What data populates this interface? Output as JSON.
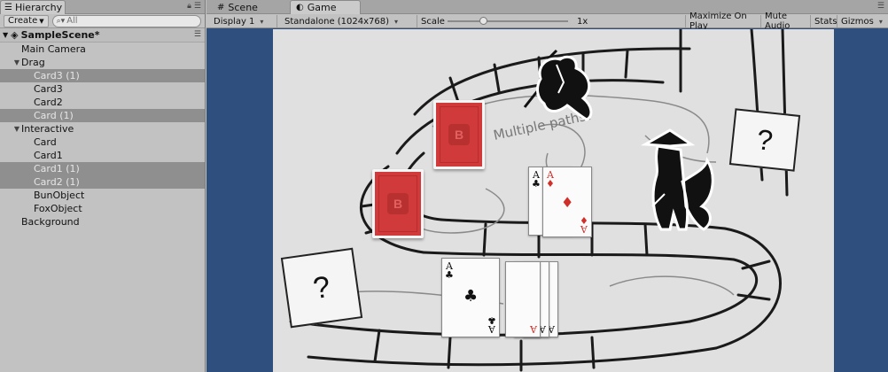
{
  "hierarchy": {
    "tab_label": "Hierarchy",
    "create_label": "Create",
    "search_placeholder": "All",
    "scene_name": "SampleScene*",
    "items": [
      {
        "label": "Main Camera",
        "depth": 1,
        "selected": false,
        "expander": ""
      },
      {
        "label": "Drag",
        "depth": 1,
        "selected": false,
        "expander": "▼"
      },
      {
        "label": "Card3 (1)",
        "depth": 2,
        "selected": true,
        "expander": ""
      },
      {
        "label": "Card3",
        "depth": 2,
        "selected": false,
        "expander": ""
      },
      {
        "label": "Card2",
        "depth": 2,
        "selected": false,
        "expander": ""
      },
      {
        "label": "Card (1)",
        "depth": 2,
        "selected": true,
        "expander": ""
      },
      {
        "label": "Interactive",
        "depth": 1,
        "selected": false,
        "expander": "▼"
      },
      {
        "label": "Card",
        "depth": 2,
        "selected": false,
        "expander": ""
      },
      {
        "label": "Card1",
        "depth": 2,
        "selected": false,
        "expander": ""
      },
      {
        "label": "Card1 (1)",
        "depth": 2,
        "selected": true,
        "expander": ""
      },
      {
        "label": "Card2 (1)",
        "depth": 2,
        "selected": true,
        "expander": ""
      },
      {
        "label": "BunObject",
        "depth": 2,
        "selected": false,
        "expander": ""
      },
      {
        "label": "FoxObject",
        "depth": 2,
        "selected": false,
        "expander": ""
      },
      {
        "label": "Background",
        "depth": 1,
        "selected": false,
        "expander": ""
      }
    ]
  },
  "view_tabs": {
    "scene_label": "Scene",
    "game_label": "Game"
  },
  "game_toolbar": {
    "display": "Display 1",
    "resolution": "Standalone (1024x768)",
    "scale_label": "Scale",
    "scale_value_text": "1x",
    "scale_fraction": 0.12,
    "maximize": "Maximize On Play",
    "mute": "Mute Audio",
    "stats": "Stats",
    "gizmos": "Gizmos"
  },
  "game_view": {
    "board_note": "Multiple paths?",
    "card_back_logo": "B",
    "question_mark": "?",
    "cards": {
      "pair_back_rank": "A",
      "pair_back_suit": "♣",
      "pair_front_rank": "A",
      "pair_front_suit": "♦",
      "spread_top_rank": "A",
      "spread_top_suit": "♣",
      "spread_under_ranks": [
        "A",
        "A",
        "A"
      ]
    }
  },
  "colors": {
    "editor_bg": "#c2c2c2",
    "selection": "#8f8f8f",
    "game_bg_blue": "#2f4f7f",
    "card_red": "#d03a3a"
  }
}
